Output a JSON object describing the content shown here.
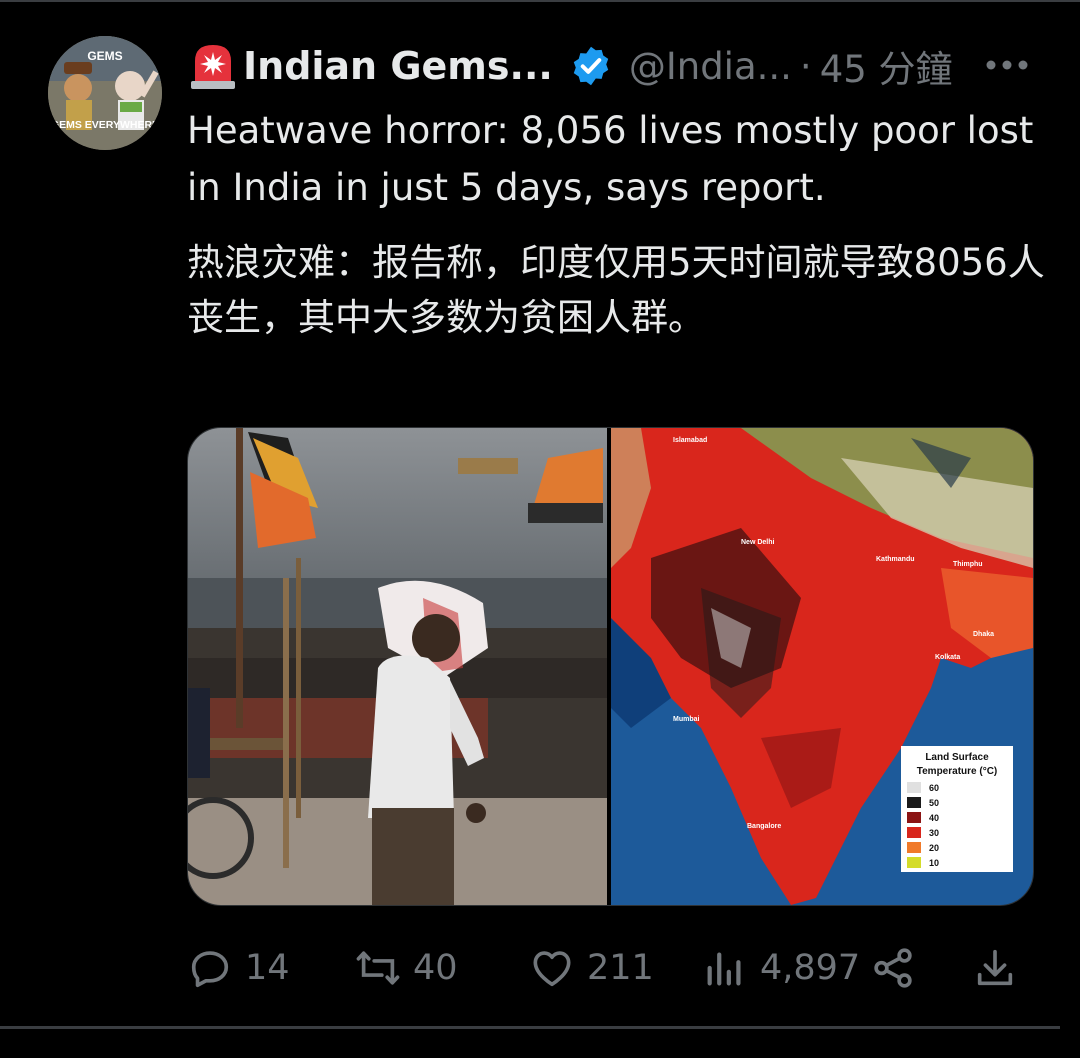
{
  "tweet": {
    "author_name": "Indian Gems...",
    "author_handle": "@India...",
    "separator": "·",
    "time": "45 分鐘",
    "avatar": {
      "text_top": "GEMS",
      "text_bottom": "GEMS EVERYWHERE"
    },
    "text_en": "Heatwave horror: 8,056 lives mostly poor lost in India in just 5 days, says report.",
    "text_zh": "热浪灾难：报告称，印度仅用5天时间就导致8056人丧生，其中大多数为贫困人群。"
  },
  "media": {
    "map": {
      "cities": [
        "Islamabad",
        "New Delhi",
        "Kathmandu",
        "Thimphu",
        "Dhaka",
        "Kolkata",
        "Mumbai",
        "Bangalore"
      ],
      "legend": {
        "title_line1": "Land Surface",
        "title_line2": "Temperature (°C)",
        "items": [
          {
            "label": "60",
            "color": "#e0e0e0"
          },
          {
            "label": "50",
            "color": "#1a1a1a"
          },
          {
            "label": "40",
            "color": "#8b1414"
          },
          {
            "label": "30",
            "color": "#d8261c"
          },
          {
            "label": "20",
            "color": "#f07a2a"
          },
          {
            "label": "10",
            "color": "#d4dc2a"
          }
        ]
      }
    }
  },
  "actions": {
    "replies": "14",
    "reposts": "40",
    "likes": "211",
    "views": "4,897"
  },
  "icons": {
    "header": [
      "siren-emoji-icon",
      "verified-badge-icon",
      "more-options-icon"
    ],
    "actions": [
      "reply-icon",
      "repost-icon",
      "like-icon",
      "views-icon",
      "share-icon",
      "download-icon"
    ]
  },
  "colors": {
    "background": "#000000",
    "text": "#e7e9ea",
    "muted": "#71767b",
    "verified": "#1d9bf0"
  }
}
